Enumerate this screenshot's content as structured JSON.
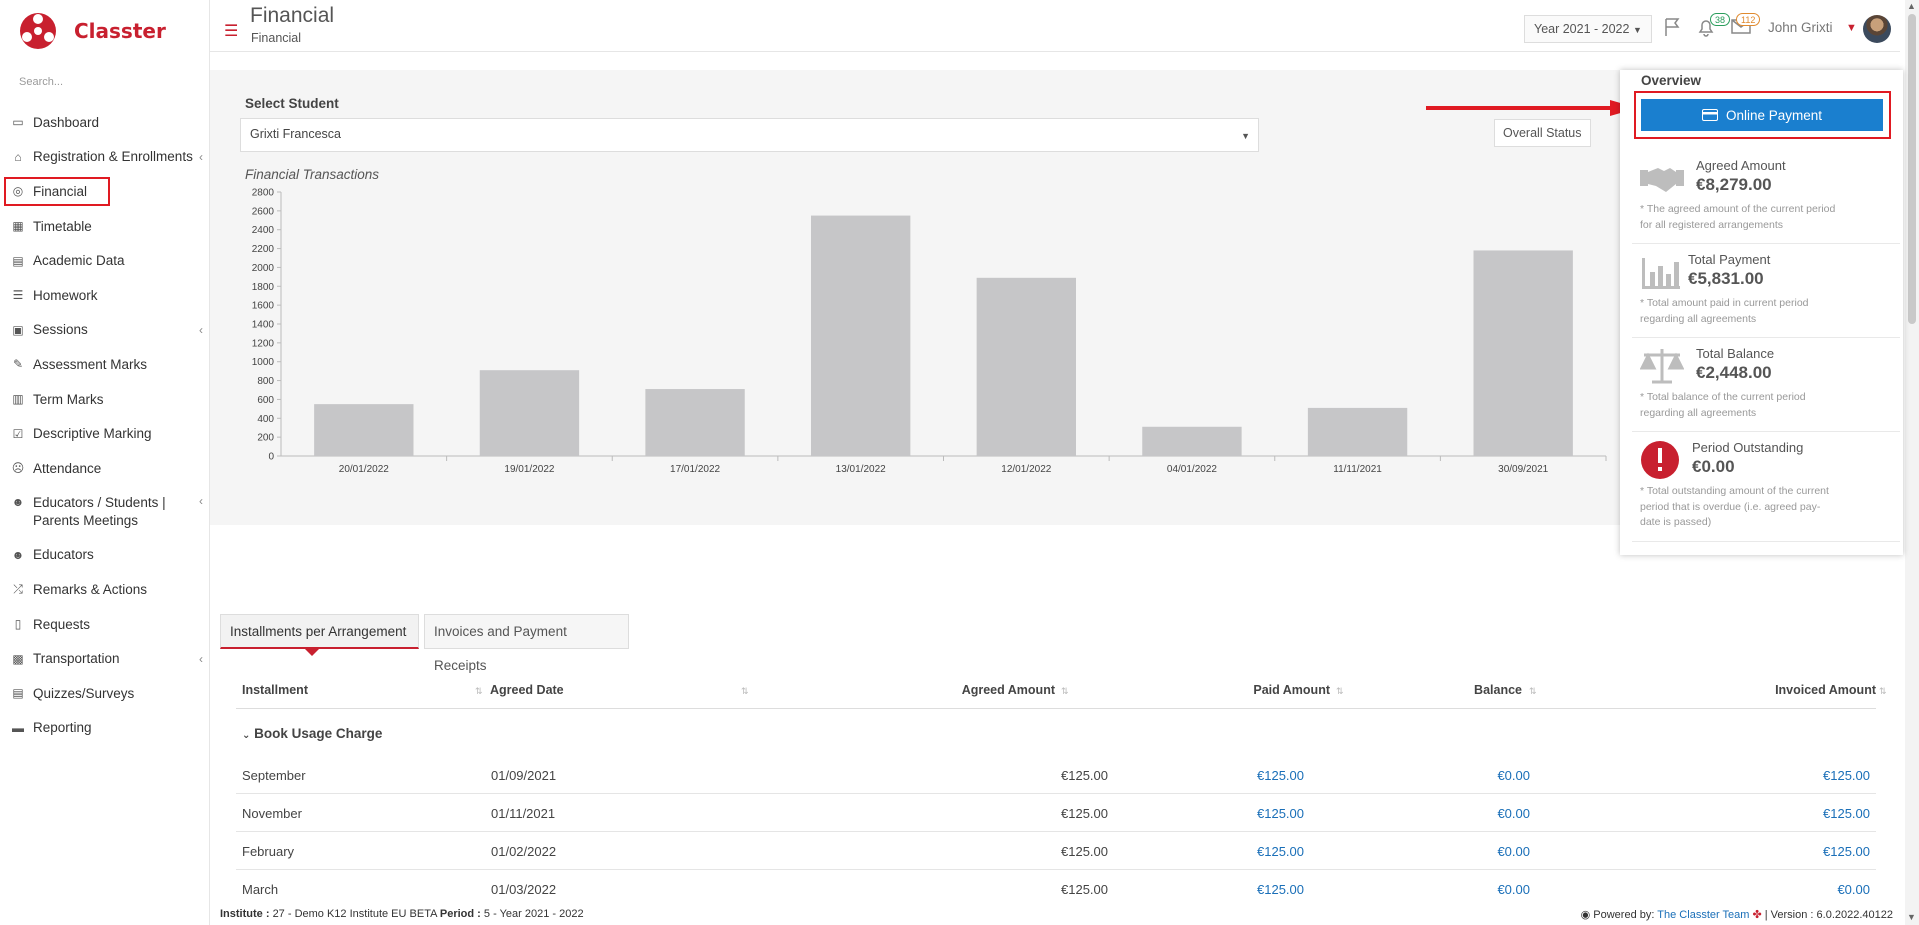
{
  "app": {
    "name": "Classter",
    "brand_color": "#c8202f",
    "accent_color": "#1a7fcf",
    "highlight_color": "#e01a22"
  },
  "sidebar": {
    "search_placeholder": "Search...",
    "items": [
      {
        "label": "Dashboard",
        "icon": "laptop-icon"
      },
      {
        "label": "Registration & Enrollments",
        "icon": "bank-icon",
        "has_submenu": true
      },
      {
        "label": "Financial",
        "icon": "coins-icon",
        "active": true
      },
      {
        "label": "Timetable",
        "icon": "calendar-icon"
      },
      {
        "label": "Academic Data",
        "icon": "id-card-icon"
      },
      {
        "label": "Homework",
        "icon": "list-icon"
      },
      {
        "label": "Sessions",
        "icon": "chalkboard-icon",
        "has_submenu": true
      },
      {
        "label": "Assessment Marks",
        "icon": "edit-icon"
      },
      {
        "label": "Term Marks",
        "icon": "book-icon"
      },
      {
        "label": "Descriptive Marking",
        "icon": "checkbox-icon"
      },
      {
        "label": "Attendance",
        "icon": "user-x-icon"
      },
      {
        "label": "Educators / Students | Parents Meetings",
        "icon": "users-icon",
        "has_submenu": true
      },
      {
        "label": "Educators",
        "icon": "users-icon"
      },
      {
        "label": "Remarks & Actions",
        "icon": "shuffle-icon"
      },
      {
        "label": "Requests",
        "icon": "file-icon"
      },
      {
        "label": "Transportation",
        "icon": "bus-icon",
        "has_submenu": true
      },
      {
        "label": "Quizzes/Surveys",
        "icon": "clipboard-icon"
      },
      {
        "label": "Reporting",
        "icon": "printer-icon"
      }
    ]
  },
  "header": {
    "title": "Financial",
    "subtitle": "Financial",
    "year_selector": "Year 2021 - 2022",
    "notifications_count": "38",
    "messages_count": "112",
    "user_name": "John Grixti"
  },
  "student": {
    "label": "Select Student",
    "selected": "Grixti Francesca",
    "overall_status_button": "Overall Status"
  },
  "chart_data": {
    "type": "bar",
    "title": "Financial Transactions",
    "categories": [
      "20/01/2022",
      "19/01/2022",
      "17/01/2022",
      "13/01/2022",
      "12/01/2022",
      "04/01/2022",
      "11/11/2021",
      "30/09/2021"
    ],
    "values": [
      550,
      910,
      710,
      2550,
      1890,
      310,
      510,
      2180
    ],
    "ylim": [
      0,
      2800
    ],
    "yticks": [
      "0",
      "200",
      "400",
      "600",
      "800",
      "1000",
      "1200",
      "1400",
      "1600",
      "1800",
      "2000",
      "2200",
      "2400",
      "2600",
      "2800"
    ],
    "bar_color": "#c6c6c8",
    "xlabel": "",
    "ylabel": ""
  },
  "overview": {
    "title": "Overview",
    "online_payment_button": "Online Payment",
    "cards": [
      {
        "title": "Agreed Amount",
        "value": "€8,279.00",
        "note": "* The agreed amount of the current period for all registered arrangements",
        "icon": "handshake-icon"
      },
      {
        "title": "Total Payment",
        "value": "€5,831.00",
        "note": "* Total amount paid in current period regarding all agreements",
        "icon": "bar-chart-icon"
      },
      {
        "title": "Total Balance",
        "value": "€2,448.00",
        "note": "* Total balance of the current period regarding all agreements",
        "icon": "scale-icon"
      },
      {
        "title": "Period Outstanding",
        "value": "€0.00",
        "note": "* Total outstanding amount of the current period that is overdue (i.e. agreed pay-date is passed)",
        "icon": "alert-icon"
      }
    ]
  },
  "tabs": [
    {
      "label": "Installments per Arrangement",
      "active": true
    },
    {
      "label": "Invoices and Payment Receipts",
      "active": false
    }
  ],
  "table": {
    "headers": [
      "Installment",
      "Agreed Date",
      "Agreed Amount",
      "Paid Amount",
      "Balance",
      "Invoiced Amount"
    ],
    "group": "Book Usage Charge",
    "rows": [
      {
        "installment": "September",
        "date": "01/09/2021",
        "agreed": "€125.00",
        "paid": "€125.00",
        "balance": "€0.00",
        "invoiced": "€125.00"
      },
      {
        "installment": "November",
        "date": "01/11/2021",
        "agreed": "€125.00",
        "paid": "€125.00",
        "balance": "€0.00",
        "invoiced": "€125.00"
      },
      {
        "installment": "February",
        "date": "01/02/2022",
        "agreed": "€125.00",
        "paid": "€125.00",
        "balance": "€0.00",
        "invoiced": "€125.00"
      },
      {
        "installment": "March",
        "date": "01/03/2022",
        "agreed": "€125.00",
        "paid": "€125.00",
        "balance": "€0.00",
        "invoiced": "€0.00"
      }
    ]
  },
  "footer": {
    "institute_label": "Institute :",
    "institute_value": "27 - Demo K12 Institute EU BETA",
    "period_label": "Period :",
    "period_value": "5 - Year 2021 - 2022",
    "powered_by": "Powered by:",
    "team_link": "The Classter Team",
    "version": "| Version : 6.0.2022.40122"
  }
}
